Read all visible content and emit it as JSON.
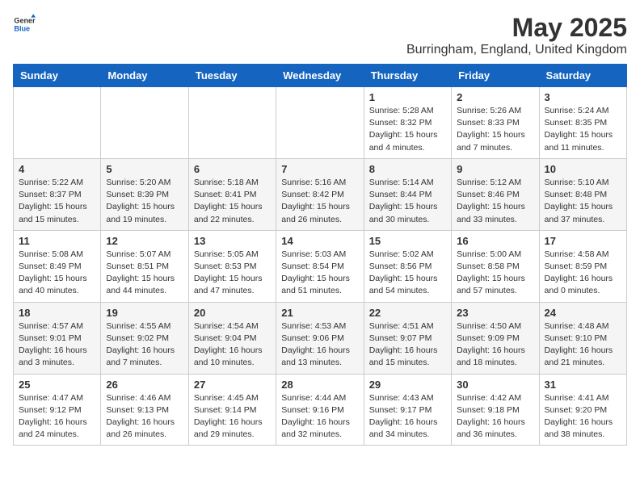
{
  "header": {
    "logo_general": "General",
    "logo_blue": "Blue",
    "title": "May 2025",
    "subtitle": "Burringham, England, United Kingdom"
  },
  "days_of_week": [
    "Sunday",
    "Monday",
    "Tuesday",
    "Wednesday",
    "Thursday",
    "Friday",
    "Saturday"
  ],
  "weeks": [
    [
      {
        "day": "",
        "info": ""
      },
      {
        "day": "",
        "info": ""
      },
      {
        "day": "",
        "info": ""
      },
      {
        "day": "",
        "info": ""
      },
      {
        "day": "1",
        "info": "Sunrise: 5:28 AM\nSunset: 8:32 PM\nDaylight: 15 hours\nand 4 minutes."
      },
      {
        "day": "2",
        "info": "Sunrise: 5:26 AM\nSunset: 8:33 PM\nDaylight: 15 hours\nand 7 minutes."
      },
      {
        "day": "3",
        "info": "Sunrise: 5:24 AM\nSunset: 8:35 PM\nDaylight: 15 hours\nand 11 minutes."
      }
    ],
    [
      {
        "day": "4",
        "info": "Sunrise: 5:22 AM\nSunset: 8:37 PM\nDaylight: 15 hours\nand 15 minutes."
      },
      {
        "day": "5",
        "info": "Sunrise: 5:20 AM\nSunset: 8:39 PM\nDaylight: 15 hours\nand 19 minutes."
      },
      {
        "day": "6",
        "info": "Sunrise: 5:18 AM\nSunset: 8:41 PM\nDaylight: 15 hours\nand 22 minutes."
      },
      {
        "day": "7",
        "info": "Sunrise: 5:16 AM\nSunset: 8:42 PM\nDaylight: 15 hours\nand 26 minutes."
      },
      {
        "day": "8",
        "info": "Sunrise: 5:14 AM\nSunset: 8:44 PM\nDaylight: 15 hours\nand 30 minutes."
      },
      {
        "day": "9",
        "info": "Sunrise: 5:12 AM\nSunset: 8:46 PM\nDaylight: 15 hours\nand 33 minutes."
      },
      {
        "day": "10",
        "info": "Sunrise: 5:10 AM\nSunset: 8:48 PM\nDaylight: 15 hours\nand 37 minutes."
      }
    ],
    [
      {
        "day": "11",
        "info": "Sunrise: 5:08 AM\nSunset: 8:49 PM\nDaylight: 15 hours\nand 40 minutes."
      },
      {
        "day": "12",
        "info": "Sunrise: 5:07 AM\nSunset: 8:51 PM\nDaylight: 15 hours\nand 44 minutes."
      },
      {
        "day": "13",
        "info": "Sunrise: 5:05 AM\nSunset: 8:53 PM\nDaylight: 15 hours\nand 47 minutes."
      },
      {
        "day": "14",
        "info": "Sunrise: 5:03 AM\nSunset: 8:54 PM\nDaylight: 15 hours\nand 51 minutes."
      },
      {
        "day": "15",
        "info": "Sunrise: 5:02 AM\nSunset: 8:56 PM\nDaylight: 15 hours\nand 54 minutes."
      },
      {
        "day": "16",
        "info": "Sunrise: 5:00 AM\nSunset: 8:58 PM\nDaylight: 15 hours\nand 57 minutes."
      },
      {
        "day": "17",
        "info": "Sunrise: 4:58 AM\nSunset: 8:59 PM\nDaylight: 16 hours\nand 0 minutes."
      }
    ],
    [
      {
        "day": "18",
        "info": "Sunrise: 4:57 AM\nSunset: 9:01 PM\nDaylight: 16 hours\nand 3 minutes."
      },
      {
        "day": "19",
        "info": "Sunrise: 4:55 AM\nSunset: 9:02 PM\nDaylight: 16 hours\nand 7 minutes."
      },
      {
        "day": "20",
        "info": "Sunrise: 4:54 AM\nSunset: 9:04 PM\nDaylight: 16 hours\nand 10 minutes."
      },
      {
        "day": "21",
        "info": "Sunrise: 4:53 AM\nSunset: 9:06 PM\nDaylight: 16 hours\nand 13 minutes."
      },
      {
        "day": "22",
        "info": "Sunrise: 4:51 AM\nSunset: 9:07 PM\nDaylight: 16 hours\nand 15 minutes."
      },
      {
        "day": "23",
        "info": "Sunrise: 4:50 AM\nSunset: 9:09 PM\nDaylight: 16 hours\nand 18 minutes."
      },
      {
        "day": "24",
        "info": "Sunrise: 4:48 AM\nSunset: 9:10 PM\nDaylight: 16 hours\nand 21 minutes."
      }
    ],
    [
      {
        "day": "25",
        "info": "Sunrise: 4:47 AM\nSunset: 9:12 PM\nDaylight: 16 hours\nand 24 minutes."
      },
      {
        "day": "26",
        "info": "Sunrise: 4:46 AM\nSunset: 9:13 PM\nDaylight: 16 hours\nand 26 minutes."
      },
      {
        "day": "27",
        "info": "Sunrise: 4:45 AM\nSunset: 9:14 PM\nDaylight: 16 hours\nand 29 minutes."
      },
      {
        "day": "28",
        "info": "Sunrise: 4:44 AM\nSunset: 9:16 PM\nDaylight: 16 hours\nand 32 minutes."
      },
      {
        "day": "29",
        "info": "Sunrise: 4:43 AM\nSunset: 9:17 PM\nDaylight: 16 hours\nand 34 minutes."
      },
      {
        "day": "30",
        "info": "Sunrise: 4:42 AM\nSunset: 9:18 PM\nDaylight: 16 hours\nand 36 minutes."
      },
      {
        "day": "31",
        "info": "Sunrise: 4:41 AM\nSunset: 9:20 PM\nDaylight: 16 hours\nand 38 minutes."
      }
    ]
  ]
}
